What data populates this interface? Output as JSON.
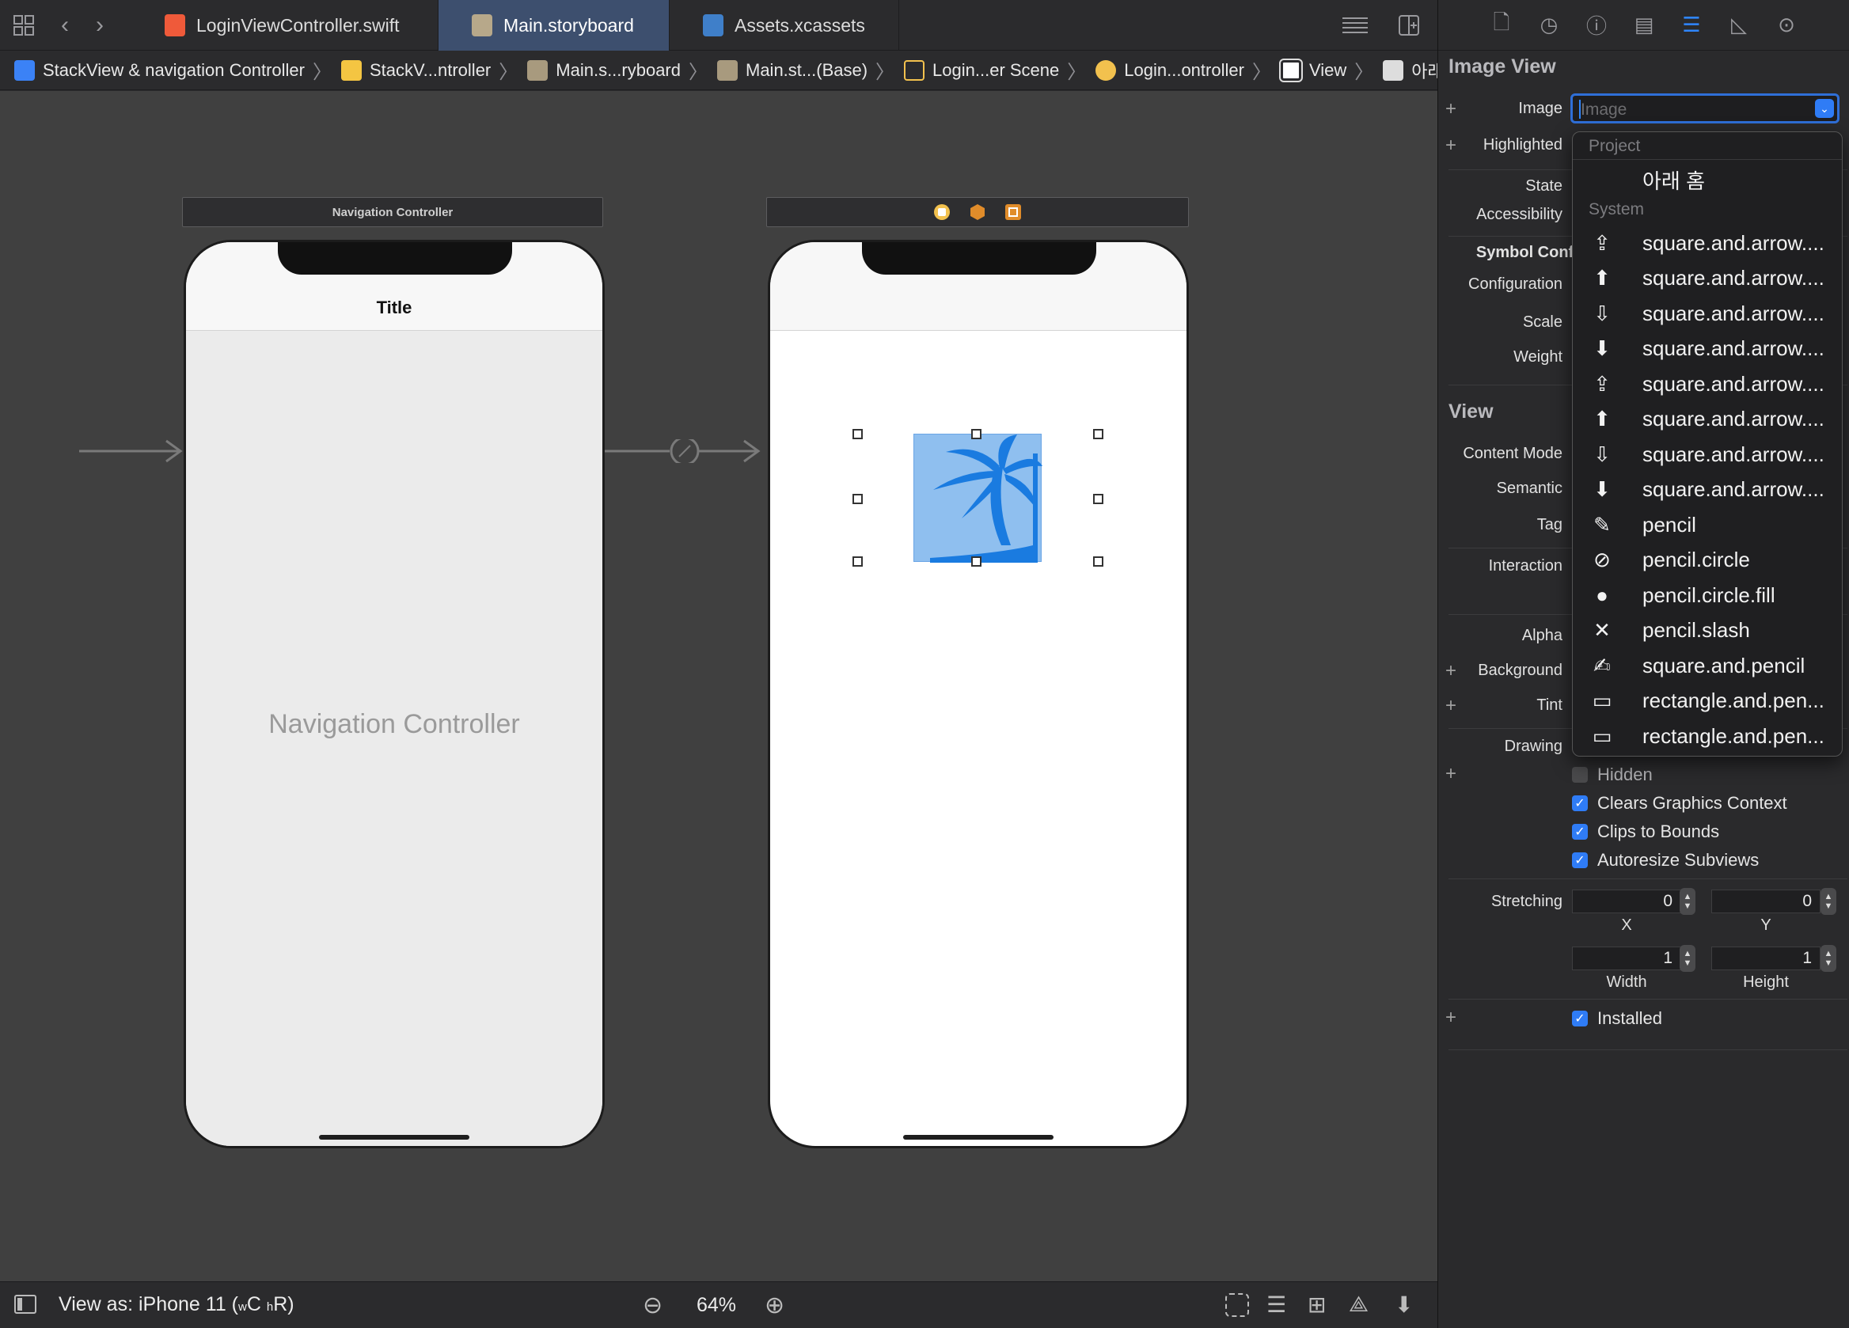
{
  "tabs": [
    {
      "label": "LoginViewController.swift",
      "icon": "swift-file-icon"
    },
    {
      "label": "Main.storyboard",
      "icon": "storyboard-icon"
    },
    {
      "label": "Assets.xcassets",
      "icon": "assets-folder-icon"
    }
  ],
  "breadcrumb": [
    "StackView & navigation Controller",
    "StackV...ntroller",
    "Main.s...ryboard",
    "Main.st...(Base)",
    "Login...er Scene",
    "Login...ontroller",
    "View",
    "아래 홈"
  ],
  "canvas": {
    "nav_scene_title": "Navigation Controller",
    "nav_bar_title": "Title",
    "nav_placeholder": "Navigation Controller"
  },
  "bottom": {
    "view_as_prefix": "View as: iPhone 11 (",
    "size_w": "w",
    "size_c": "C",
    "size_h": "h",
    "size_r": "R)",
    "zoom": "64%"
  },
  "inspector": {
    "image_view_header": "Image View",
    "image_label": "Image",
    "image_placeholder": "Image",
    "highlighted_label": "Highlighted",
    "state_label": "State",
    "accessibility_label": "Accessibility",
    "symbol_config_label": "Symbol Config",
    "configuration_label": "Configuration",
    "scale_label": "Scale",
    "weight_label": "Weight",
    "view_header": "View",
    "content_mode_label": "Content Mode",
    "semantic_label": "Semantic",
    "tag_label": "Tag",
    "interaction_label": "Interaction",
    "alpha_label": "Alpha",
    "background_label": "Background",
    "tint_label": "Tint",
    "drawing_label": "Drawing",
    "hidden_label": "Hidden",
    "hidden_checked": false,
    "clears_label": "Clears Graphics Context",
    "clears_checked": true,
    "clips_label": "Clips to Bounds",
    "clips_checked": true,
    "autoresize_label": "Autoresize Subviews",
    "autoresize_checked": true,
    "stretching_label": "Stretching",
    "stretch_x": "0",
    "stretch_y": "0",
    "stretch_x_label": "X",
    "stretch_y_label": "Y",
    "stretch_w": "1",
    "stretch_h": "1",
    "stretch_w_label": "Width",
    "stretch_h_label": "Height",
    "installed_label": "Installed",
    "installed_checked": true
  },
  "dropdown": {
    "project_header": "Project",
    "project_item": "아래 홈",
    "system_header": "System",
    "items": [
      {
        "label": "square.and.arrow....",
        "icon": "share-icon"
      },
      {
        "label": "square.and.arrow....",
        "icon": "share-fill-icon"
      },
      {
        "label": "square.and.arrow....",
        "icon": "download-icon"
      },
      {
        "label": "square.and.arrow....",
        "icon": "download-fill-icon"
      },
      {
        "label": "square.and.arrow....",
        "icon": "share-stack-icon"
      },
      {
        "label": "square.and.arrow....",
        "icon": "share-stack-fill-icon"
      },
      {
        "label": "square.and.arrow....",
        "icon": "download-stack-icon"
      },
      {
        "label": "square.and.arrow....",
        "icon": "download-stack-fill-icon"
      },
      {
        "label": "pencil",
        "icon": "pencil-icon"
      },
      {
        "label": "pencil.circle",
        "icon": "pencil-circle-icon"
      },
      {
        "label": "pencil.circle.fill",
        "icon": "pencil-circle-fill-icon"
      },
      {
        "label": "pencil.slash",
        "icon": "pencil-slash-icon"
      },
      {
        "label": "square.and.pencil",
        "icon": "square-pencil-icon"
      },
      {
        "label": "rectangle.and.pen...",
        "icon": "rectangle-pencil-icon"
      },
      {
        "label": "rectangle.and.pen...",
        "icon": "rectangle-pencil-2-icon"
      }
    ]
  },
  "colors": {
    "accent": "#2f7cf6",
    "canvas_bg": "#404040",
    "active_tab": "#3d4f6e",
    "image_tint": "#8fbfef",
    "image_symbol": "#1a7be0"
  }
}
